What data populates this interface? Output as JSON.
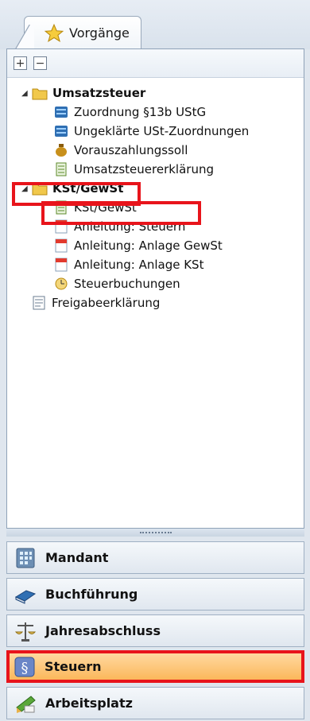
{
  "tab": {
    "label": "Vorgänge",
    "icon": "star-icon"
  },
  "toolbar": {
    "expand_label": "+",
    "collapse_label": "−"
  },
  "tree": {
    "umsatzsteuer": {
      "label": "Umsatzsteuer",
      "children": [
        "Zuordnung §13b UStG",
        "Ungeklärte USt-Zuordnungen",
        "Vorauszahlungssoll",
        "Umsatzsteuererklärung"
      ]
    },
    "kst": {
      "label": "KSt/GewSt",
      "children": [
        "KSt/GewSt",
        "Anleitung: Steuern",
        "Anleitung: Anlage GewSt",
        "Anleitung: Anlage KSt",
        "Steuerbuchungen"
      ]
    },
    "freigabe": "Freigabeerklärung"
  },
  "nav": [
    {
      "label": "Mandant",
      "icon": "building-icon",
      "active": false
    },
    {
      "label": "Buchführung",
      "icon": "book-icon",
      "active": false
    },
    {
      "label": "Jahresabschluss",
      "icon": "scales-icon",
      "active": false
    },
    {
      "label": "Steuern",
      "icon": "paragraph-icon",
      "active": true
    },
    {
      "label": "Arbeitsplatz",
      "icon": "desk-icon",
      "active": false
    }
  ],
  "colors": {
    "highlight": "#e8141b",
    "active_nav": "#fbb85b",
    "folder": "#f1c84b"
  }
}
